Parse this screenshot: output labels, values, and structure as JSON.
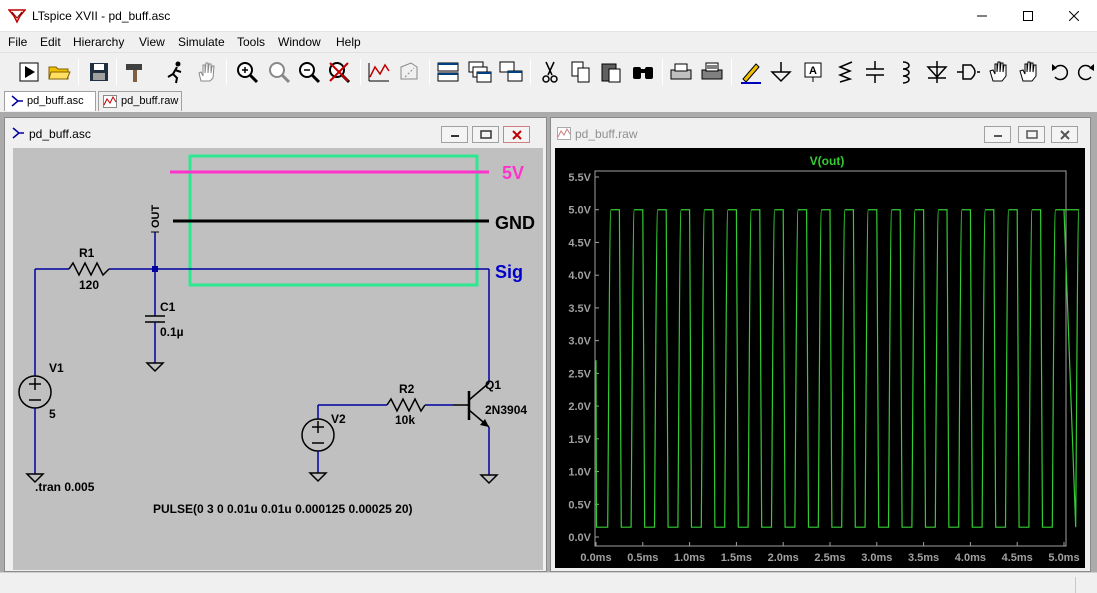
{
  "window": {
    "title": "LTspice XVII - pd_buff.asc"
  },
  "menu": [
    "File",
    "Edit",
    "Hierarchy",
    "View",
    "Simulate",
    "Tools",
    "Window",
    "Help"
  ],
  "toolbar_icons": [
    "run-icon",
    "open-icon",
    "save-icon",
    "hammer-icon",
    "probe-run-icon",
    "hand-icon",
    "zoom-in-icon",
    "zoom-fit-icon",
    "zoom-out-icon",
    "zoom-cancel-icon",
    "autoscale-icon",
    "plot-settings-icon",
    "tile-horizontal-icon",
    "cascade-icon",
    "tile-icon",
    "cut-icon",
    "copy-icon",
    "paste-icon",
    "find-icon",
    "print-icon",
    "print-setup-icon",
    "pencil-icon",
    "ground-icon",
    "label-icon",
    "resistor-icon",
    "capacitor-icon",
    "inductor-icon",
    "diode-icon",
    "component-icon",
    "move-icon",
    "drag-icon",
    "undo-icon",
    "redo-icon"
  ],
  "tabs": [
    {
      "label": "pd_buff.asc",
      "active": true
    },
    {
      "label": "pd_buff.raw",
      "active": false
    }
  ],
  "schematic_window": {
    "title": "pd_buff.asc",
    "net_labels": {
      "out": "OUT",
      "v5": "5V",
      "gnd": "GND",
      "sig": "Sig"
    },
    "components": {
      "r1": {
        "name": "R1",
        "value": "120"
      },
      "c1": {
        "name": "C1",
        "value": "0.1µ"
      },
      "v1": {
        "name": "V1",
        "value": "5"
      },
      "v2": {
        "name": "V2"
      },
      "r2": {
        "name": "R2",
        "value": "10k"
      },
      "q1": {
        "name": "Q1",
        "value": "2N3904"
      }
    },
    "directives": {
      "tran": ".tran 0.005",
      "pulse": "PULSE(0 3 0 0.01u 0.01u 0.000125 0.00025 20)"
    },
    "colors": {
      "background": "#c0c0c0",
      "wire": "#0000a0",
      "label_5v": "#ff33cc",
      "label_sig": "#0000cc",
      "highlight_box": "#2ee88f"
    }
  },
  "waveform_window": {
    "title": "pd_buff.raw",
    "trace_label": "V(out)",
    "colors": {
      "background": "#000000",
      "trace": "#33cc33",
      "axis": "#a0a0a0"
    }
  },
  "chart_data": {
    "type": "line",
    "title": "V(out)",
    "y_ticks": [
      "5.5V",
      "5.0V",
      "4.5V",
      "4.0V",
      "3.5V",
      "3.0V",
      "2.5V",
      "2.0V",
      "1.5V",
      "1.0V",
      "0.5V",
      "0.0V"
    ],
    "x_ticks": [
      "0.0ms",
      "0.5ms",
      "1.0ms",
      "1.5ms",
      "2.0ms",
      "2.5ms",
      "3.0ms",
      "3.5ms",
      "4.0ms",
      "4.5ms",
      "5.0ms"
    ],
    "xlim": [
      0,
      5.0
    ],
    "ylim": [
      0,
      5.5
    ],
    "series": [
      {
        "signal": "square wave, period 0.25 ms, high phase 0.125 ms",
        "x_ms": [
          0.0,
          0.0,
          0.125,
          0.125,
          0.25,
          0.25,
          0.375,
          0.375,
          0.5
        ],
        "y_v": [
          2.7,
          0.15,
          0.15,
          5.0,
          5.0,
          0.15,
          0.15,
          5.0,
          5.0
        ],
        "low_v": 0.15,
        "high_v": 5.0,
        "period_ms": 0.25,
        "low_time_ms": 0.125
      }
    ]
  }
}
